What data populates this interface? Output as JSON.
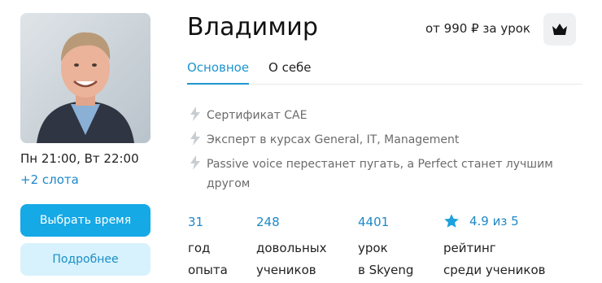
{
  "tutor": {
    "name": "Владимир",
    "price": "от 990 ₽ за урок"
  },
  "schedule": {
    "times": "Пн 21:00, Вт 22:00",
    "more_slots": "+2 слота"
  },
  "buttons": {
    "choose_time": "Выбрать время",
    "details": "Подробнее"
  },
  "tabs": [
    {
      "label": "Основное",
      "active": true
    },
    {
      "label": "О себе",
      "active": false
    }
  ],
  "features": [
    {
      "icon": "bolt-icon",
      "text": "Сертификат CAE"
    },
    {
      "icon": "bolt-icon",
      "text": "Эксперт в курсах General, IT, Management"
    },
    {
      "icon": "bolt-icon",
      "text": "Passive voice перестанет пугать, а Perfect станет лучшим другом"
    }
  ],
  "stats": [
    {
      "value": "31",
      "label_line1": "год",
      "label_line2": "опыта"
    },
    {
      "value": "248",
      "label_line1": "довольных",
      "label_line2": "учеников"
    },
    {
      "value": "4401",
      "label_line1": "урок",
      "label_line2": "в Skyeng"
    },
    {
      "value": "4.9 из 5",
      "label_line1": "рейтинг",
      "label_line2": "среди учеников",
      "icon": "star-icon"
    }
  ],
  "colors": {
    "accent": "#15a9e6",
    "link": "#1e88c8",
    "secondary_bg": "#d7f2fc",
    "icon_gray": "#c8cdd1"
  }
}
